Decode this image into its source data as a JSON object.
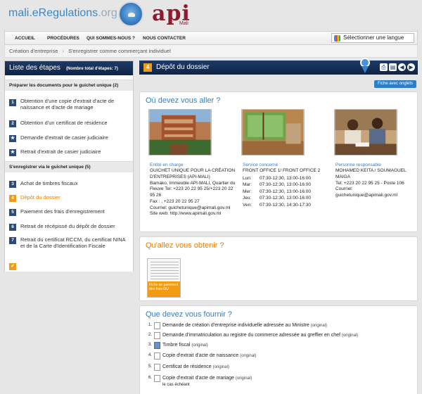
{
  "header": {
    "logo_main": "mali.eRegulations",
    "logo_suffix": ".org",
    "api_logo": "api",
    "api_sub": "Mali"
  },
  "nav": {
    "items": [
      "ACCUEIL",
      "PROCÉDURES",
      "QUI SOMMES-NOUS ?",
      "NOUS CONTACTER"
    ],
    "language_select": "Sélectionner une langue"
  },
  "breadcrumb": [
    "Création d'entreprise",
    "S'enregistrer comme commerçant individuel"
  ],
  "sidebar": {
    "title": "Liste des étapes",
    "total": "(Nombre total d'étapes: 7)",
    "sections": [
      {
        "label": "Préparer les documents pour le guichet unique  (2)",
        "items": [
          {
            "badge": "1",
            "label": "Obtention d'une copie d'extrait d'acte de naissance et d'acte de mariage"
          },
          {
            "badge": "2",
            "label": "Obtention d'un certificat de résidence"
          },
          {
            "badge": "★",
            "label": "Demande d'extrait de casier judiciaire"
          },
          {
            "badge": "★",
            "label": "Retrait d'extrait de casier judiciaire"
          }
        ]
      },
      {
        "label": "S'enregistrer via le guichet unique  (5)",
        "items": [
          {
            "badge": "3",
            "label": "Achat de timbres fiscaux"
          },
          {
            "badge": "4",
            "label": "Dépôt du dossier",
            "active": true
          },
          {
            "badge": "5",
            "label": "Paiement des frais d'enregistrement"
          },
          {
            "badge": "6",
            "label": "Retrait de récépissé du dépôt de dossier"
          },
          {
            "badge": "7",
            "label": "Retrait du certificat RCCM, du certificat NINA et de la Carte d'Identification Fiscale"
          }
        ]
      }
    ],
    "final_badge": "✔"
  },
  "main": {
    "step_number": "4",
    "step_title": "Dépôt du dossier",
    "fiche_button": "Fiche avec onglets",
    "where": {
      "title": "Où devez vous aller ?",
      "entity": {
        "label": "Entité en charge",
        "name": "GUICHET UNIQUE POUR LA CRÉATION D'ENTREPRISES (API-MALI)",
        "address": "Bamako, Immeuble API-MALI, Quartier du Fleuve Tel: +223 20 22 95 25/+223 20 22 95 26",
        "fax": "Fax : , +223 20 22 95 27",
        "email": "Courriel: guichetunique@apimali.gov.ml",
        "web": "Site web: http://www.apimali.gov.ml"
      },
      "service": {
        "label": "Service concerné",
        "name": "FRONT OFFICE 1/ FRONT OFFICE 2",
        "schedule": [
          {
            "day": "Lun:",
            "hours": "07:30-12:30, 13:00-16:00"
          },
          {
            "day": "Mar:",
            "hours": "07:30-12:30, 13:00-16:00"
          },
          {
            "day": "Mer:",
            "hours": "07:30-12:30, 13:00-16:00"
          },
          {
            "day": "Jeu:",
            "hours": "07:30-12:30, 13:00-16:00"
          },
          {
            "day": "Ven:",
            "hours": "07:30-12:30, 14:30-17:30"
          }
        ]
      },
      "person": {
        "label": "Personne responsable",
        "name": "MOHAMED KEITA / SOUMAGUEL MAIGA",
        "tel": "Tel: +223 20 22 95 25 - Poste 106",
        "email_label": "Courriel:",
        "email": "guichetunique@apimali.gov.ml"
      }
    },
    "obtain": {
      "title": "Qu'allez vous obtenir ?",
      "doc_label": "Fiche de paiement des frais GU"
    },
    "provide": {
      "title": "Que devez vous fournir ?",
      "items": [
        {
          "num": "1.",
          "label": "Demande de création d'entreprise individuelle adressée au Ministre",
          "tag": "(original)"
        },
        {
          "num": "2.",
          "label": "Demande d'immatriculation au registre du commerce adressée au greffier en chef",
          "tag": "(original)"
        },
        {
          "num": "3.",
          "label": "Timbre fiscal",
          "tag": "(original)"
        },
        {
          "num": "4.",
          "label": "Copie d'extrait d'acte de naissance",
          "tag": "(original)"
        },
        {
          "num": "5.",
          "label": "Certificat de résidence",
          "tag": "(original)"
        },
        {
          "num": "6.",
          "label": "Copie d'extrait d'acte de mariage",
          "tag": "(original)",
          "sub": "le cas échéant"
        }
      ]
    }
  },
  "colors": {
    "navy": "#1d3a66",
    "orange": "#f39c12",
    "blue": "#2f7fc6"
  }
}
